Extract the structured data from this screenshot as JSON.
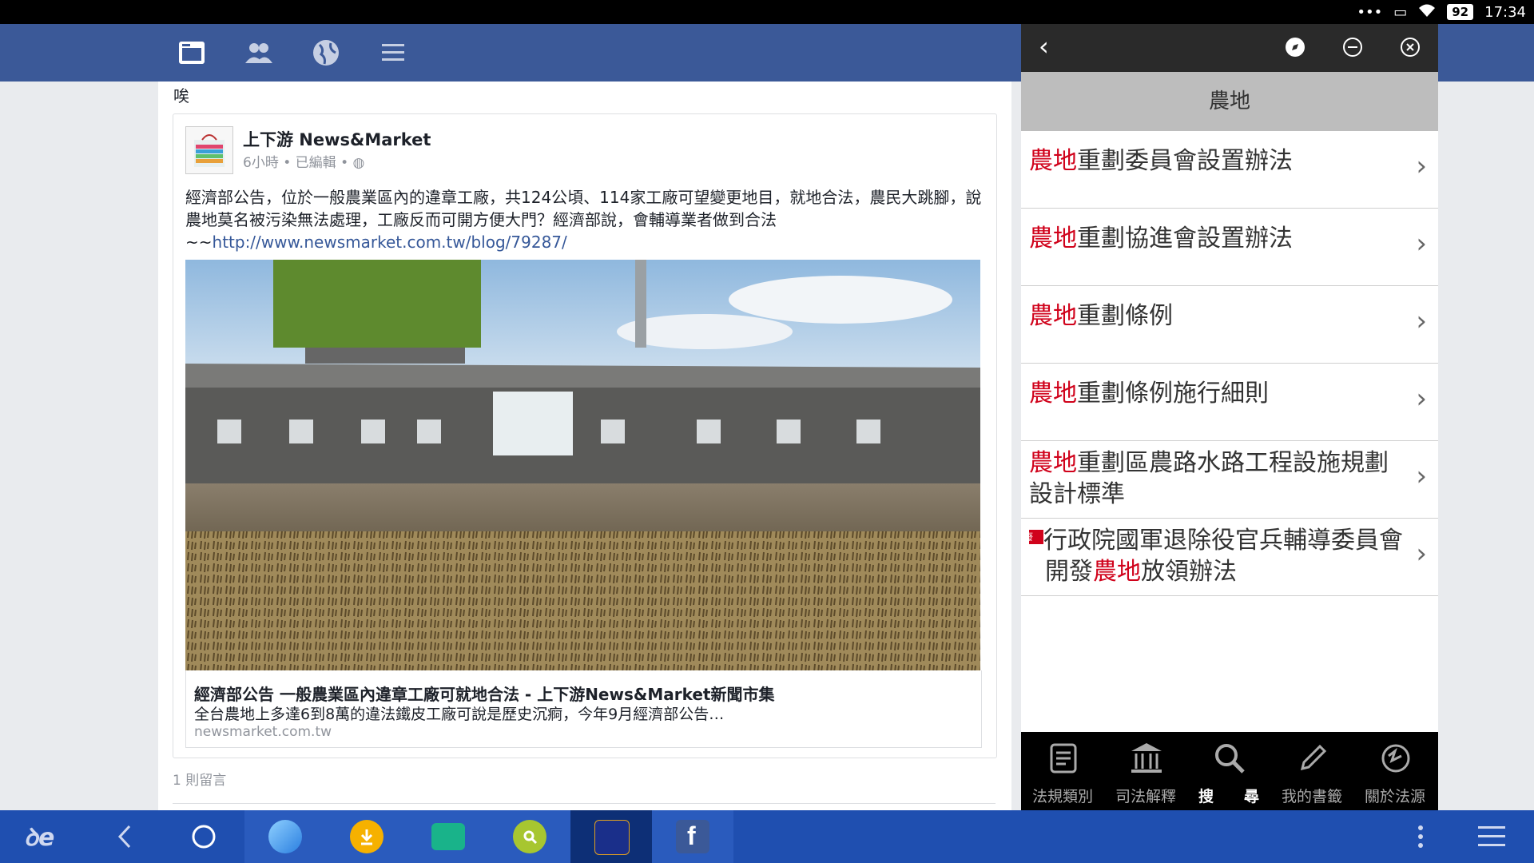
{
  "status_bar": {
    "dots": "•••",
    "battery": "92",
    "time": "17:34"
  },
  "fb": {
    "header_icons": [
      "newsfeed-icon",
      "friends-icon",
      "globe-icon",
      "menu-icon"
    ],
    "top_word": "唉",
    "post": {
      "page_name": "上下游 News&Market",
      "time": "6小時",
      "edited": "已編輯",
      "body": "經濟部公告，位於一般農業區內的違章工廠，共124公頃、114家工廠可望變更地目，就地合法，農民大跳腳，說農地莫名被污染無法處理，工廠反而可開方便大門？經濟部說，會輔導業者做到合法~~",
      "link_url": "http://www.newsmarket.com.tw/blog/79287/",
      "link_title": "經濟部公告 一般農業區內違章工廠可就地合法 - 上下游News&Market新聞市集",
      "link_desc": "全台農地上多達6到8萬的違法鐵皮工廠可說是歷史沉痾，今年9月經濟部公告…",
      "link_domain": "newsmarket.com.tw"
    },
    "comments": "1 則留言"
  },
  "law_app": {
    "title": "農地",
    "results": [
      {
        "hl": "農地",
        "rest": "重劃委員會設置辦法"
      },
      {
        "hl": "農地",
        "rest": "重劃協進會設置辦法"
      },
      {
        "hl": "農地",
        "rest": "重劃條例"
      },
      {
        "hl": "農地",
        "rest": "重劃條例施行細則"
      },
      {
        "hl": "農地",
        "rest": "重劃區農路水路工程設施規劃設計標準"
      },
      {
        "pre": "行政院國軍退除役官兵輔導委員會開發",
        "hl": "農地",
        "rest": "放領辦法",
        "badge": "廢"
      }
    ],
    "tabs": [
      "法規類別",
      "司法解釋",
      "搜　　尋",
      "我的書籤",
      "關於法源"
    ]
  },
  "colors": {
    "fb_blue": "#3b5998",
    "highlight": "#d0021b",
    "taskbar": "#1f4fb0"
  }
}
